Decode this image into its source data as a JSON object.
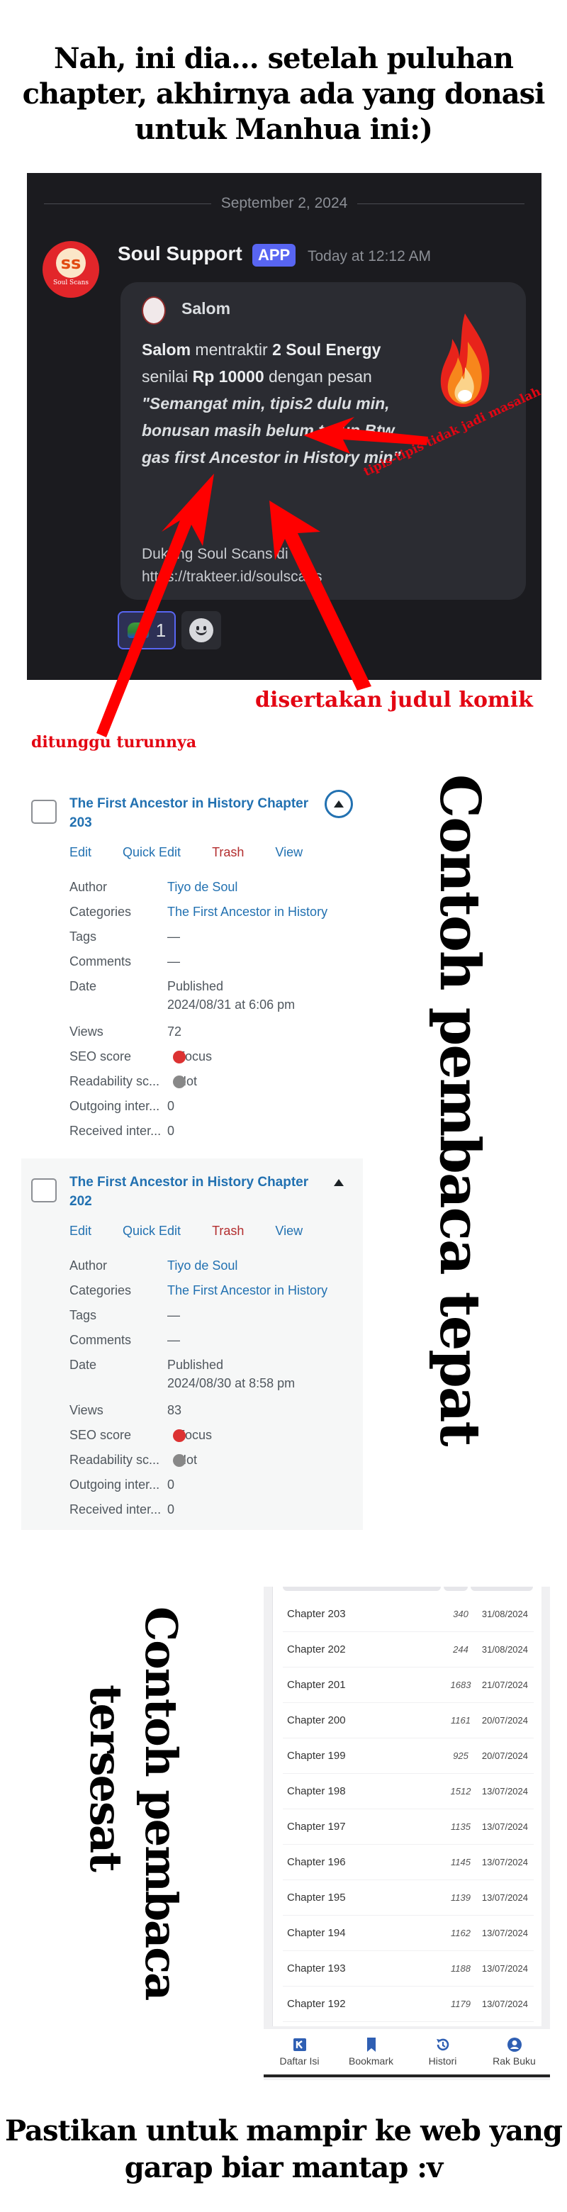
{
  "top_heading": "Nah, ini dia... setelah puluhan chapter, akhirnya ada yang donasi untuk Manhua ini:)",
  "discord": {
    "date_divider": "September 2, 2024",
    "avatar_brand": "Soul Scans",
    "username": "Soul Support",
    "app_badge": "APP",
    "timestamp": "Today at 12:12 AM",
    "embed": {
      "author": "Salom",
      "body": {
        "donor": "Salom",
        "text1": " mentraktir ",
        "amount_item": "2 Soul Energy",
        "text2": " senilai ",
        "amount_money": "Rp 10000",
        "text3": " dengan pesan ",
        "message": "\"Semangat min, tipis2 dulu min, bonusan masih belum turun Btw gas first Ancestor in History min\""
      },
      "footer": "Dukung Soul Scans di https://trakteer.id/soulscans",
      "thumbnail_icon": "fire-icon"
    },
    "reactions": [
      {
        "emoji": "pepe-emoji",
        "count": "1"
      },
      {
        "emoji": "add-reaction-smiley-icon"
      }
    ],
    "colors": {
      "background": "#1b1b1f",
      "embed": "#2b2c32",
      "app_badge": "#5865f2"
    }
  },
  "annotations": {
    "tipis": "tipis-tipis tidak jadi masalah",
    "judul": "disertakan judul komik",
    "ditunggu": "ditunggu turunnya",
    "color": "#e30613"
  },
  "wp_posts": {
    "actions": {
      "edit": "Edit",
      "quick_edit": "Quick Edit",
      "trash": "Trash",
      "view": "View"
    },
    "labels": {
      "author": "Author",
      "categories": "Categories",
      "tags": "Tags",
      "comments": "Comments",
      "date": "Date",
      "views": "Views",
      "seo": "SEO score",
      "readability": "Readability sc...",
      "outgoing": "Outgoing inter...",
      "received": "Received inter..."
    },
    "items": [
      {
        "title": "The First Ancestor in History Chapter 203",
        "author": "Tiyo de Soul",
        "categories": "The First Ancestor in History",
        "tags": "—",
        "comments": "—",
        "date_status": "Published",
        "date": "2024/08/31 at 6:06 pm",
        "views": "72",
        "seo": "Focus",
        "readability": "Not",
        "outgoing": "0",
        "received": "0"
      },
      {
        "title": "The First Ancestor in History Chapter 202",
        "author": "Tiyo de Soul",
        "categories": "The First Ancestor in History",
        "tags": "—",
        "comments": "—",
        "date_status": "Published",
        "date": "2024/08/30 at 8:58 pm",
        "views": "83",
        "seo": "Focus",
        "readability": "Not",
        "outgoing": "0",
        "received": "0"
      }
    ]
  },
  "vertical_right": "Contoh pembaca tepat",
  "vertical_left": {
    "line1": "Contoh pembaca",
    "line2": "tersesat"
  },
  "reader": {
    "chapters": [
      {
        "name": "Chapter 203",
        "views": "340",
        "date": "31/08/2024"
      },
      {
        "name": "Chapter 202",
        "views": "244",
        "date": "31/08/2024"
      },
      {
        "name": "Chapter 201",
        "views": "1683",
        "date": "21/07/2024"
      },
      {
        "name": "Chapter 200",
        "views": "1161",
        "date": "20/07/2024"
      },
      {
        "name": "Chapter 199",
        "views": "925",
        "date": "20/07/2024"
      },
      {
        "name": "Chapter 198",
        "views": "1512",
        "date": "13/07/2024"
      },
      {
        "name": "Chapter 197",
        "views": "1135",
        "date": "13/07/2024"
      },
      {
        "name": "Chapter 196",
        "views": "1145",
        "date": "13/07/2024"
      },
      {
        "name": "Chapter 195",
        "views": "1139",
        "date": "13/07/2024"
      },
      {
        "name": "Chapter 194",
        "views": "1162",
        "date": "13/07/2024"
      },
      {
        "name": "Chapter 193",
        "views": "1188",
        "date": "13/07/2024"
      },
      {
        "name": "Chapter 192",
        "views": "1179",
        "date": "13/07/2024"
      }
    ],
    "nav": [
      {
        "label": "Daftar Isi",
        "icon": "table-of-contents-icon"
      },
      {
        "label": "Bookmark",
        "icon": "bookmark-icon"
      },
      {
        "label": "Histori",
        "icon": "history-icon"
      },
      {
        "label": "Rak Buku",
        "icon": "account-icon"
      }
    ],
    "accent": "#2f5fb3"
  },
  "bottom_heading": "Pastikan untuk mampir ke web yang garap biar mantap :v"
}
